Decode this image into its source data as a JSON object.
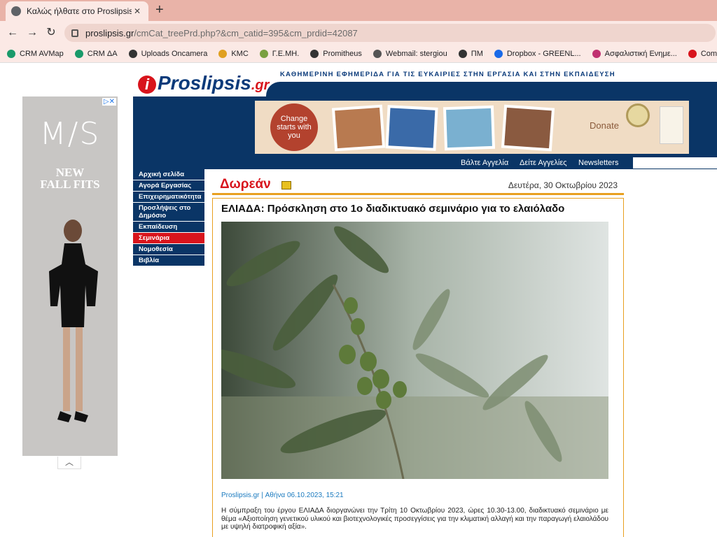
{
  "browser": {
    "tab_title": "Καλώς ήλθατε στο Proslipsis.gr",
    "tab_close": "✕",
    "new_tab": "+",
    "url_host": "proslipsis.gr",
    "url_path": "/cmCat_treePrd.php?&cm_catid=395&cm_prdid=42087",
    "bookmarks": [
      {
        "label": "CRM AVMap",
        "color": "#1a9a6a"
      },
      {
        "label": "CRM ΔΑ",
        "color": "#1a9a6a"
      },
      {
        "label": "Uploads Oncamera",
        "color": "#333333"
      },
      {
        "label": "KMC",
        "color": "#e0a020"
      },
      {
        "label": "Γ.Ε.ΜΗ.",
        "color": "#7aa040"
      },
      {
        "label": "Promitheus",
        "color": "#333333"
      },
      {
        "label": "Webmail: stergiou",
        "color": "#555555"
      },
      {
        "label": "ΠΜ",
        "color": "#333333"
      },
      {
        "label": "Dropbox - GREENL...",
        "color": "#1a6ae8"
      },
      {
        "label": "Ασφαλιστική Ενημε...",
        "color": "#c03070"
      },
      {
        "label": "Compress PDFs",
        "color": "#d8141c"
      }
    ]
  },
  "ad": {
    "brand": "M/S",
    "tagline_1": "NEW",
    "tagline_2": "FALL FITS",
    "close": "▷✕",
    "collapse": "︿"
  },
  "header": {
    "logo_i": "i",
    "logo_name": "Proslipsis",
    "logo_tld": ".gr",
    "tagline": "ΚΑΘΗΜΕΡΙΝΗ ΕΦΗΜΕΡΙΔΑ ΓΙΑ ΤΙΣ ΕΥΚΑΙΡΙΕΣ ΣΤΗΝ ΕΡΓΑΣΙΑ ΚΑΙ ΣΤΗΝ ΕΚΠΑΙΔΕΥΣΗ",
    "banner_circle": "Change starts with you",
    "banner_donate": "Donate",
    "nav": [
      "Βάλτε Αγγελία",
      "Δείτε Αγγελίες",
      "Newsletters"
    ]
  },
  "menu": [
    {
      "label": "Αρχική σελίδα",
      "active": false
    },
    {
      "label": "Αγορά Εργασίας",
      "active": false
    },
    {
      "label": "Επιχειρηματικότητα",
      "active": false
    },
    {
      "label": "Προσλήψεις στο Δημόσιο",
      "active": false
    },
    {
      "label": "Εκπαίδευση",
      "active": false
    },
    {
      "label": "Σεμινάρια",
      "active": true
    },
    {
      "label": "Νομοθεσία",
      "active": false
    },
    {
      "label": "Βιβλία",
      "active": false
    }
  ],
  "content": {
    "category": "Δωρεάν",
    "date": "Δευτέρα, 30 Οκτωβρίου 2023",
    "title": "ΕΛΙΑΔΑ: Πρόσκληση στο 1ο διαδικτυακό σεμινάριο για το ελαιόλαδο",
    "byline": "Proslipsis.gr | Αθήνα 06.10.2023, 15:21",
    "body": "Η σύμπραξη του έργου ΕΛΙΑΔΑ διοργανώνει την Τρίτη 10 Οκτωβρίου 2023, ώρες 10.30-13.00, διαδικτυακό σεμινάριο με θέμα «Αξιοποίηση γενετικού υλικού και βιοτεχνολογικές προσεγγίσεις  για την κλιματική αλλαγή και την παραγωγή ελαιολάδου με υψηλή διατροφική αξία»."
  },
  "colors": {
    "navy": "#0a3566",
    "red": "#d8141c",
    "orange": "#e8a020",
    "chrome": "#e9b3a8"
  }
}
